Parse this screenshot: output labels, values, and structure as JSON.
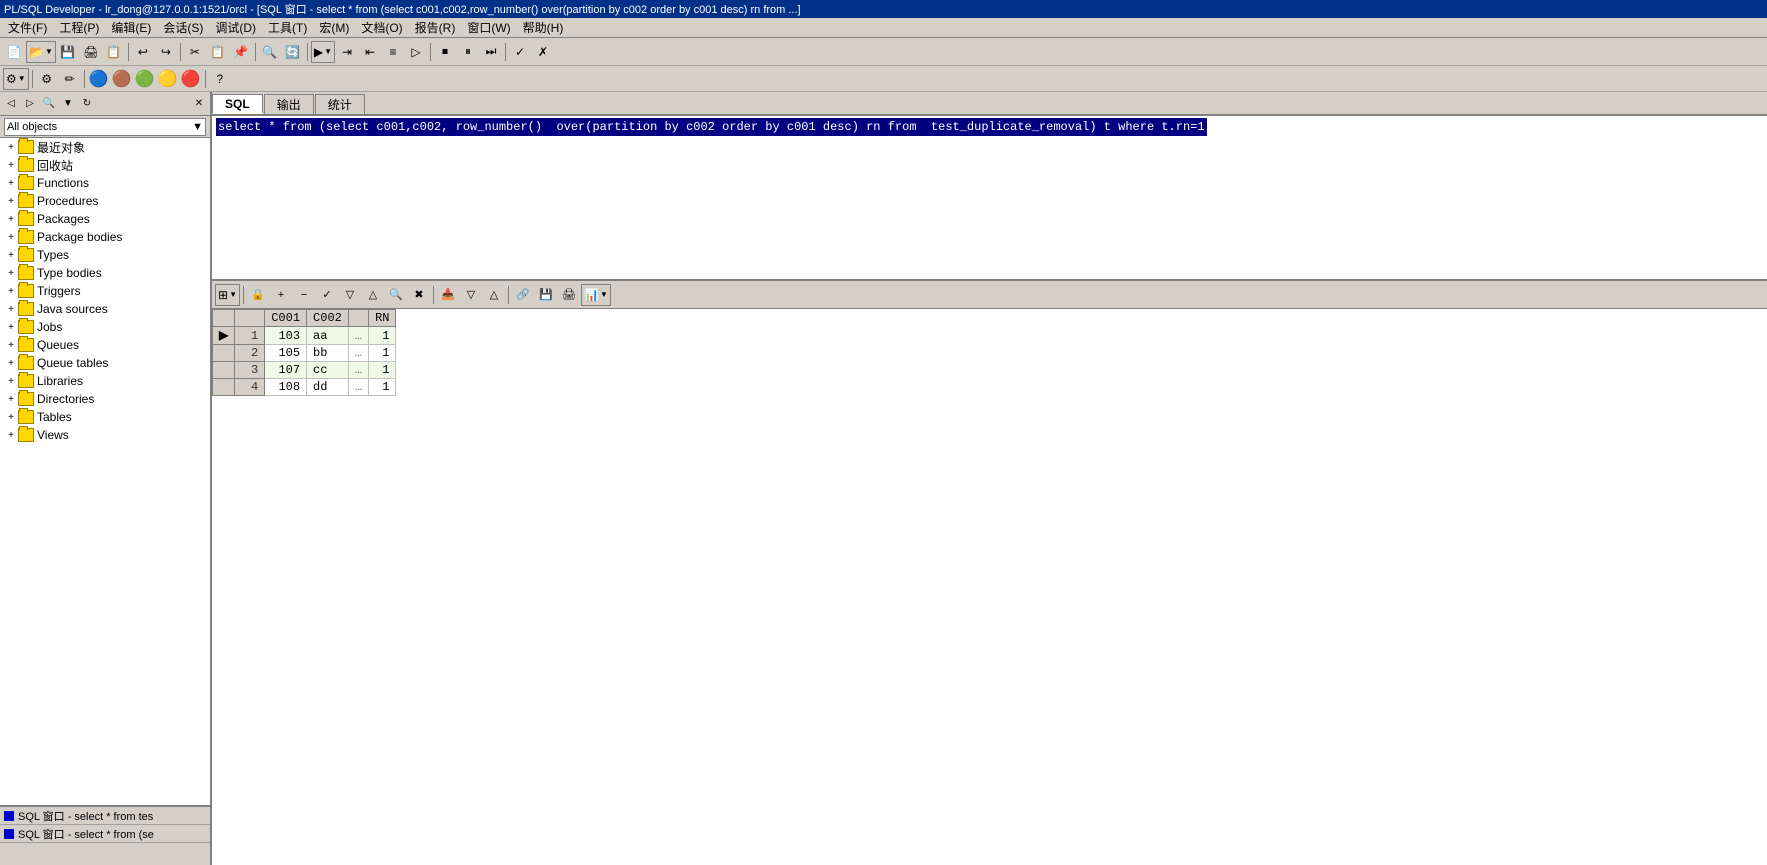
{
  "titleBar": {
    "text": "PL/SQL Developer - lr_dong@127.0.0.1:1521/orcl - [SQL 窗口 - select * from (select c001,c002,row_number() over(partition by c002 order by c001 desc) rn from ...]"
  },
  "menuBar": {
    "items": [
      "文件(F)",
      "工程(P)",
      "编辑(E)",
      "会话(S)",
      "调试(D)",
      "工具(T)",
      "宏(M)",
      "文档(O)",
      "报告(R)",
      "窗口(W)",
      "帮助(H)"
    ]
  },
  "tabs": {
    "items": [
      "SQL",
      "输出",
      "统计"
    ],
    "active": 0
  },
  "sqlEditor": {
    "content": "select * from (select c001,c002, row_number()  over(partition by c002 order by c001 desc) rn from  test_duplicate_removal) t where t.rn=1"
  },
  "leftPanel": {
    "objectsLabel": "All objects",
    "treeItems": [
      {
        "label": "最近对象",
        "type": "folder",
        "indent": 0
      },
      {
        "label": "回收站",
        "type": "folder",
        "indent": 0
      },
      {
        "label": "Functions",
        "type": "folder",
        "indent": 0
      },
      {
        "label": "Procedures",
        "type": "folder",
        "indent": 0
      },
      {
        "label": "Packages",
        "type": "folder",
        "indent": 0
      },
      {
        "label": "Package bodies",
        "type": "folder",
        "indent": 0
      },
      {
        "label": "Types",
        "type": "folder",
        "indent": 0
      },
      {
        "label": "Type bodies",
        "type": "folder",
        "indent": 0
      },
      {
        "label": "Triggers",
        "type": "folder",
        "indent": 0
      },
      {
        "label": "Java sources",
        "type": "folder",
        "indent": 0
      },
      {
        "label": "Jobs",
        "type": "folder",
        "indent": 0
      },
      {
        "label": "Queues",
        "type": "folder",
        "indent": 0
      },
      {
        "label": "Queue tables",
        "type": "folder",
        "indent": 0
      },
      {
        "label": "Libraries",
        "type": "folder",
        "indent": 0
      },
      {
        "label": "Directories",
        "type": "folder",
        "indent": 0
      },
      {
        "label": "Tables",
        "type": "folder",
        "indent": 0
      },
      {
        "label": "Views",
        "type": "folder",
        "indent": 0
      }
    ]
  },
  "bottomPanel": {
    "items": [
      "SQL 窗口 - select * from tes",
      "SQL 窗口 - select * from (se"
    ]
  },
  "resultsTable": {
    "columns": [
      "",
      "",
      "C001",
      "C002",
      "RN"
    ],
    "rows": [
      {
        "indicator": "▶",
        "num": "1",
        "c001": "103",
        "c002": "aa",
        "dots": "…",
        "rn": "1"
      },
      {
        "indicator": "",
        "num": "2",
        "c001": "105",
        "c002": "bb",
        "dots": "…",
        "rn": "1"
      },
      {
        "indicator": "",
        "num": "3",
        "c001": "107",
        "c002": "cc",
        "dots": "…",
        "rn": "1"
      },
      {
        "indicator": "",
        "num": "4",
        "c001": "108",
        "c002": "dd",
        "dots": "…",
        "rn": "1"
      }
    ]
  },
  "toolbar1": {
    "buttons": [
      "new",
      "open",
      "save",
      "print",
      "print-prev",
      "undo",
      "redo",
      "cut",
      "copy",
      "paste",
      "find",
      "replace",
      "run",
      "run-all",
      "stop"
    ]
  },
  "toolbar2": {
    "buttons": [
      "config",
      "pencil",
      "compile1",
      "compile2",
      "connect1",
      "connect2",
      "connect3",
      "connect4",
      "help"
    ]
  }
}
